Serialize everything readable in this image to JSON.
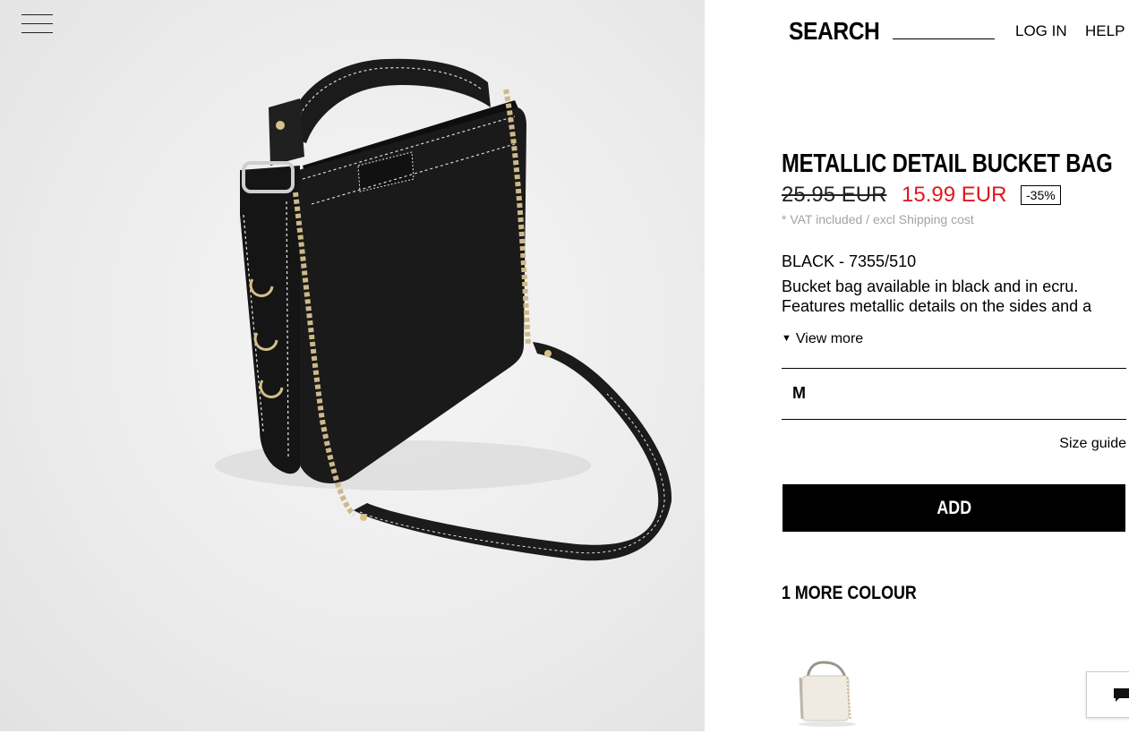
{
  "header": {
    "search_label": "SEARCH",
    "search_value": "",
    "login_label": "LOG IN",
    "help_label": "HELP",
    "menu_icon": "hamburger-icon"
  },
  "product": {
    "title": "METALLIC DETAIL BUCKET BAG",
    "old_price": "25.95 EUR",
    "new_price": "15.99 EUR",
    "discount": "-35%",
    "vat_note": "* VAT included / excl Shipping cost",
    "color_code": "BLACK - 7355/510",
    "description_line1": "Bucket bag available in black and in ecru.",
    "description_line2": "Features metallic details on the sides and a",
    "view_more_label": "View more",
    "selected_size": "M",
    "size_guide_label": "Size guide",
    "add_label": "ADD",
    "more_colours_label": "1 MORE COLOUR"
  },
  "colors": {
    "sale_red": "#e0161e",
    "button_black": "#000000",
    "muted_grey": "#a3a3a3"
  },
  "icons": {
    "chat": "chat-bubble-icon",
    "view_more": "caret-down-icon"
  }
}
